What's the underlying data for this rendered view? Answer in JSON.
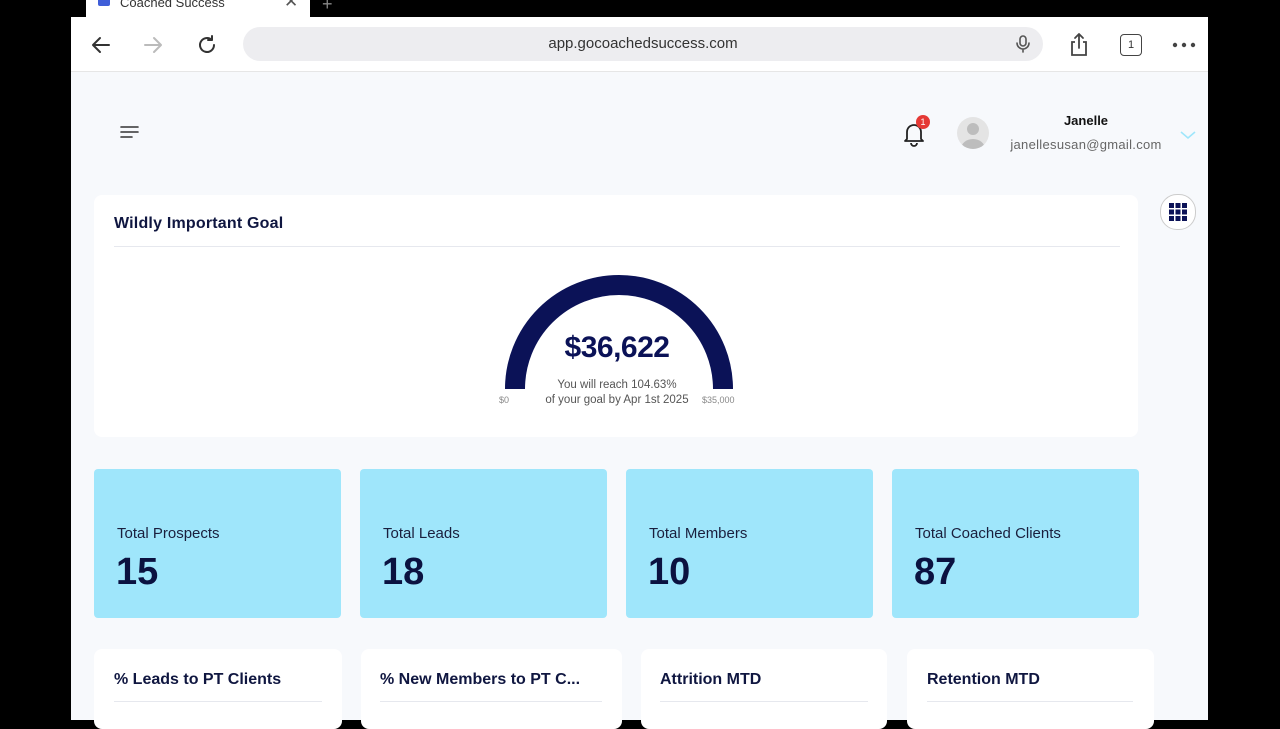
{
  "browser": {
    "tab_title": "Coached Success",
    "url": "app.gocoachedsuccess.com",
    "tab_count": "1"
  },
  "header": {
    "notification_count": "1",
    "user_name": "Janelle",
    "user_email": "janellesusan@gmail.com"
  },
  "goal": {
    "title": "Wildly Important Goal",
    "amount": "$36,622",
    "reach_line1": "You will reach 104.63%",
    "reach_line2": "of your goal by Apr 1st 2025",
    "min_label": "$0",
    "max_label": "$35,000",
    "progress_fraction": 1.0
  },
  "stats": [
    {
      "label": "Total Prospects",
      "value": "15"
    },
    {
      "label": "Total Leads",
      "value": "18"
    },
    {
      "label": "Total Members",
      "value": "10"
    },
    {
      "label": "Total Coached Clients",
      "value": "87"
    }
  ],
  "kpis": [
    {
      "title": "% Leads to PT Clients"
    },
    {
      "title": "% New Members to PT C..."
    },
    {
      "title": "Attrition MTD"
    },
    {
      "title": "Retention MTD"
    }
  ],
  "colors": {
    "accent": "#0b1257",
    "stat_bg": "#9fe6fb",
    "badge": "#e53935"
  }
}
